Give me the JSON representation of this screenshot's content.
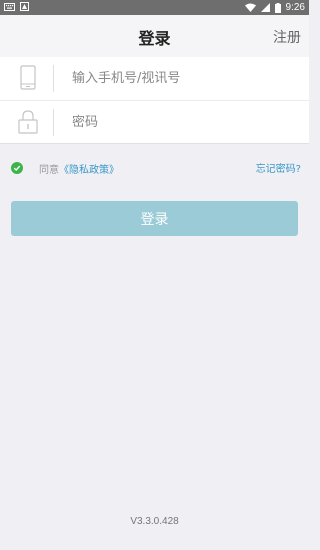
{
  "status_bar": {
    "time": "9:26"
  },
  "header": {
    "title": "登录",
    "register_label": "注册"
  },
  "form": {
    "phone_placeholder": "输入手机号/视讯号",
    "password_placeholder": "密码"
  },
  "agreement": {
    "prefix": "同意",
    "policy_link": "《隐私政策》",
    "checked": true
  },
  "forgot_password": "忘记密码?",
  "login_button": "登录",
  "footer": {
    "version": "V3.3.0.428"
  },
  "colors": {
    "accent": "#3a98c8",
    "button": "#9ccbd8",
    "check": "#3bb54a"
  }
}
